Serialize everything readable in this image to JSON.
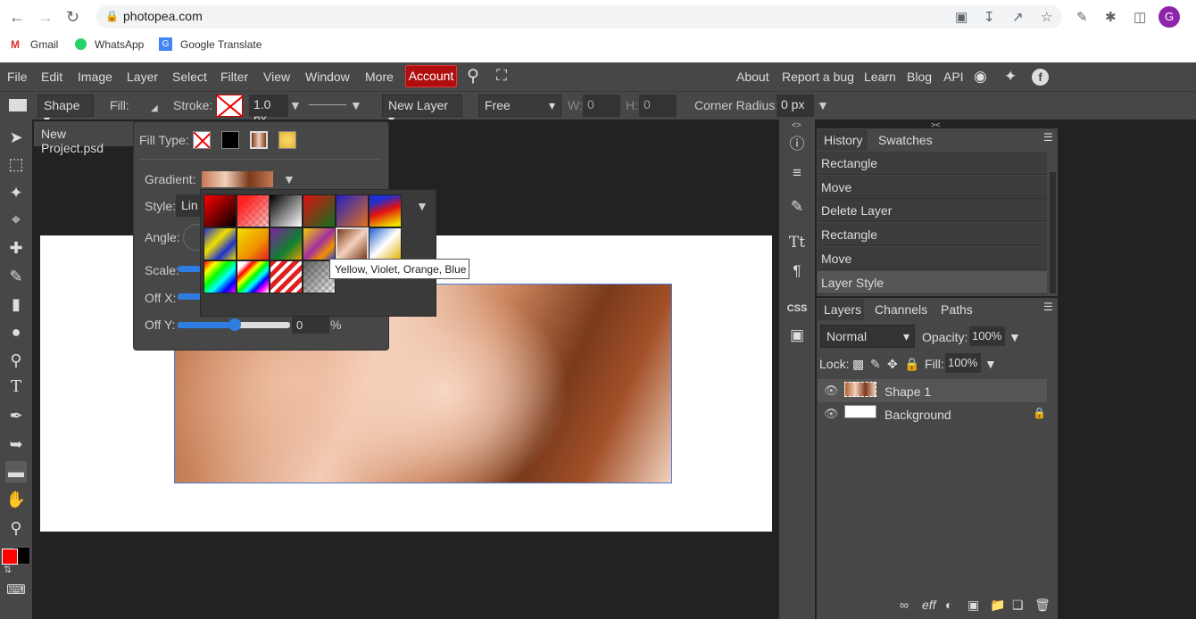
{
  "browser": {
    "url": "photopea.com",
    "bookmarks": [
      "Gmail",
      "WhatsApp",
      "Google Translate"
    ],
    "profile_initial": "G"
  },
  "menu": {
    "items": [
      "File",
      "Edit",
      "Image",
      "Layer",
      "Select",
      "Filter",
      "View",
      "Window",
      "More"
    ],
    "account": "Account",
    "right": [
      "About",
      "Report a bug",
      "Learn",
      "Blog",
      "API"
    ]
  },
  "options": {
    "mode": "Shape",
    "fill_label": "Fill:",
    "stroke_label": "Stroke:",
    "stroke_width": "1.0 px",
    "layer_mode": "New Layer",
    "constraint": "Free",
    "w_label": "W:",
    "w_value": "0",
    "h_label": "H:",
    "h_value": "0",
    "corner_label": "Corner Radius:",
    "corner_value": "0 px"
  },
  "document": {
    "tab": "New Project.psd"
  },
  "fill_popup": {
    "fill_type_label": "Fill Type:",
    "gradient_label": "Gradient:",
    "style_label": "Style:",
    "style_value": "Lin",
    "angle_label": "Angle:",
    "scale_label": "Scale:",
    "offx_label": "Off X:",
    "offy_label": "Off Y:",
    "offy_value": "0",
    "offy_pct": 0.5,
    "percent": "%"
  },
  "gradient_picker": {
    "tooltip": "Yellow, Violet, Orange, Blue"
  },
  "history": {
    "tabs": [
      "History",
      "Swatches"
    ],
    "items": [
      "Rectangle",
      "Move",
      "Delete Layer",
      "Rectangle",
      "Move",
      "Layer Style"
    ]
  },
  "layers": {
    "tabs": [
      "Layers",
      "Channels",
      "Paths"
    ],
    "blend": "Normal",
    "opacity_label": "Opacity:",
    "opacity": "100%",
    "lock_label": "Lock:",
    "fill_label": "Fill:",
    "fill": "100%",
    "rows": [
      {
        "name": "Shape 1"
      },
      {
        "name": "Background"
      }
    ]
  },
  "colors": {
    "foreground": "#ff0000",
    "background": "#000000"
  }
}
